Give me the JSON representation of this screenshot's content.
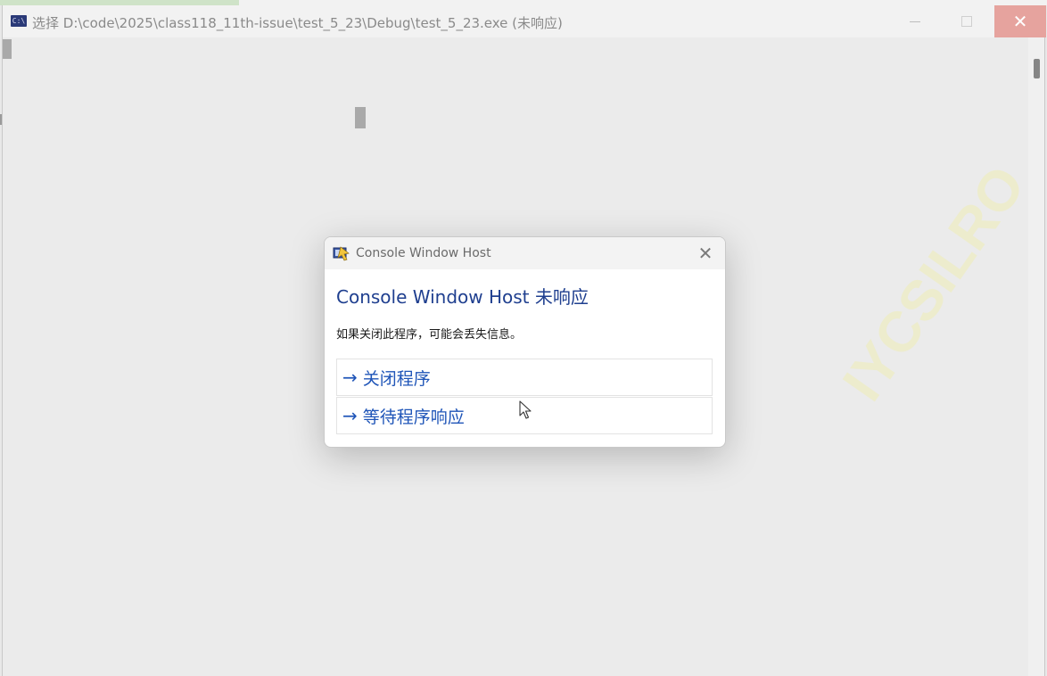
{
  "window": {
    "icon_text": "C:\\",
    "title": "选择 D:\\code\\2025\\class118_11th-issue\\test_5_23\\Debug\\test_5_23.exe (未响应)",
    "controls": {
      "minimize_icon": "minimize-icon",
      "maximize_icon": "maximize-icon",
      "close_icon": "close-icon",
      "close_glyph": "✕"
    }
  },
  "dialog": {
    "title": "Console Window Host",
    "close_glyph": "✕",
    "heading": "Console Window Host 未响应",
    "message": "如果关闭此程序，可能会丢失信息。",
    "options": [
      {
        "arrow": "→",
        "label": "关闭程序"
      },
      {
        "arrow": "→",
        "label": "等待程序响应"
      }
    ]
  },
  "watermark": "IYCSILRO",
  "colors": {
    "accent": "#1f55b8",
    "heading": "#1f3f8f",
    "close_hover": "#e6a39e"
  }
}
